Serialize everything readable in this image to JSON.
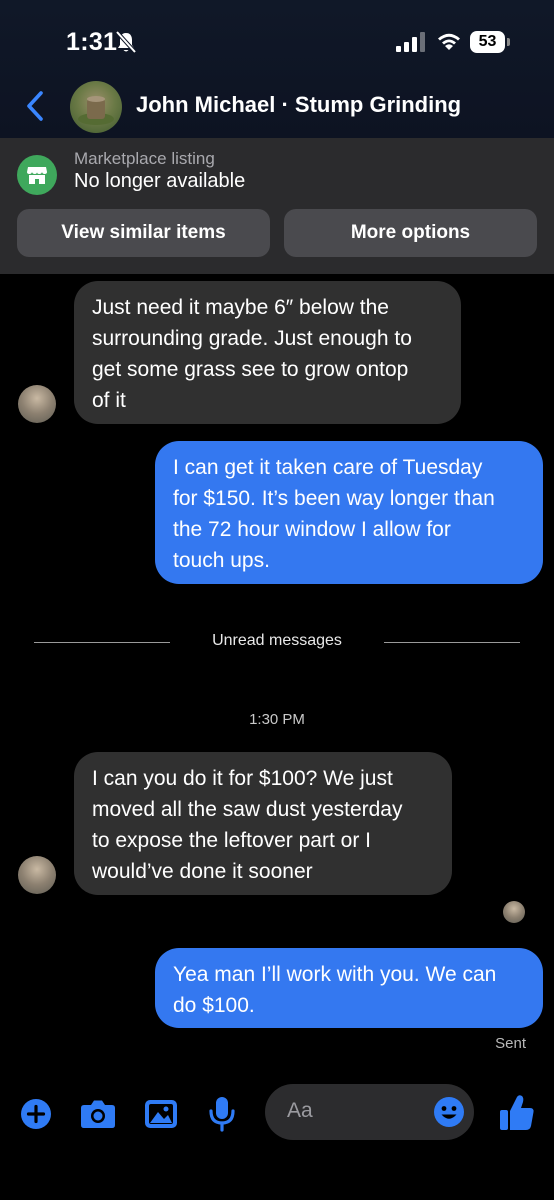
{
  "status_bar": {
    "time": "1:31",
    "battery": "53"
  },
  "header": {
    "contact_name": "John Michael · Stump Grinding"
  },
  "listing": {
    "label": "Marketplace listing",
    "status": "No longer available",
    "btn_view_similar": "View similar items",
    "btn_more_options": "More options"
  },
  "messages": [
    {
      "direction": "in",
      "lines": [
        "Just need it maybe 6″ below the",
        "surrounding grade. Just enough to",
        "get some grass see to grow ontop",
        "of it"
      ]
    },
    {
      "direction": "out",
      "lines": [
        "I can get it taken care of Tuesday",
        "for $150. It’s been way longer than",
        "the 72 hour window I allow for",
        "touch ups."
      ]
    },
    {
      "direction": "in",
      "lines": [
        "I can you do it for $100? We just",
        "moved all the saw dust yesterday",
        "to expose the leftover part or I",
        "would’ve done it sooner"
      ]
    },
    {
      "direction": "out",
      "lines": [
        "Yea man I’ll work with you. We can",
        "do $100."
      ]
    }
  ],
  "divider": {
    "unread_label": "Unread messages"
  },
  "timestamp": "1:30 PM",
  "sent_status": "Sent",
  "composer": {
    "placeholder": "Aa"
  },
  "colors": {
    "accent": "#3478f0",
    "incoming_bubble": "#303030",
    "listing_bg": "#2b2b2d",
    "icon_blue": "#2f7bf5"
  }
}
